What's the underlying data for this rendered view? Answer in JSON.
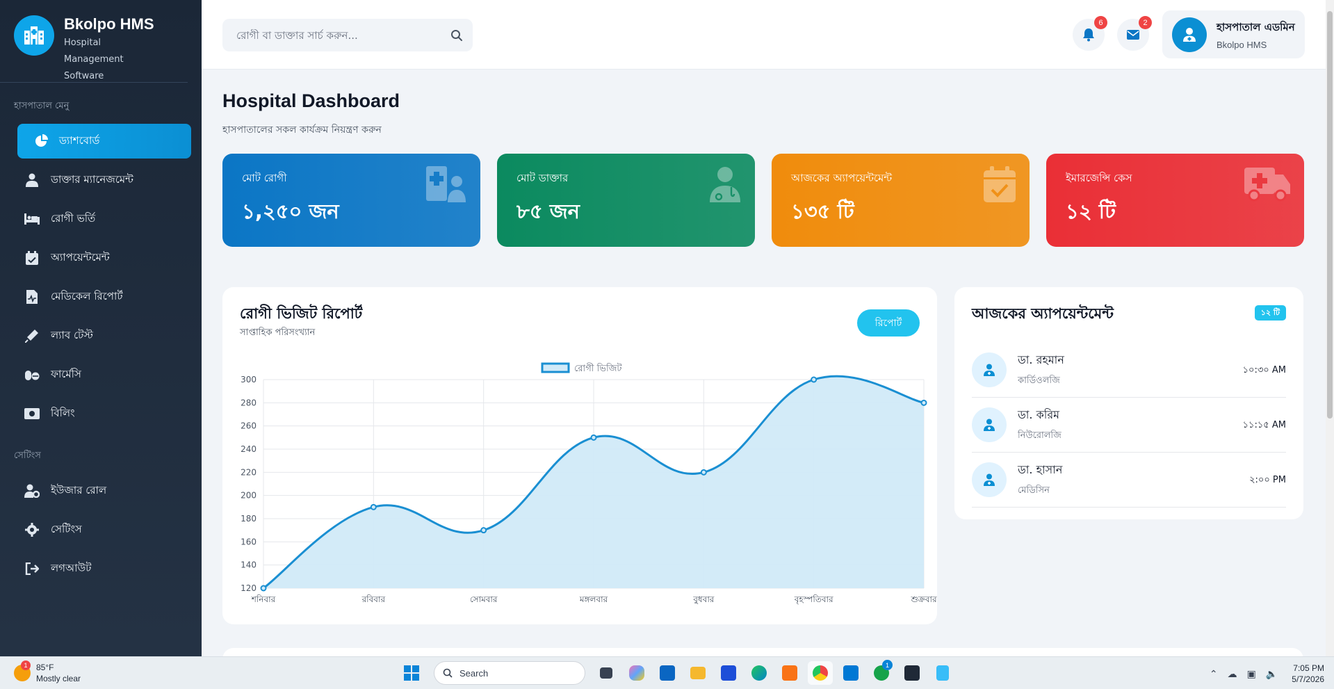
{
  "brand": {
    "name": "Bkolpo HMS",
    "subtitle": "Hospital Management Software"
  },
  "sidebar": {
    "menu_title": "হাসপাতাল মেনু",
    "items": [
      {
        "label": "ড্যাশবোর্ড",
        "icon": "pie-chart-icon",
        "active": true
      },
      {
        "label": "ডাক্তার ম্যানেজমেন্ট",
        "icon": "user-doctor-icon"
      },
      {
        "label": "রোগী ভর্তি",
        "icon": "bed-icon"
      },
      {
        "label": "অ্যাপয়েন্টমেন্ট",
        "icon": "calendar-check-icon"
      },
      {
        "label": "মেডিকেল রিপোর্ট",
        "icon": "file-medical-icon"
      },
      {
        "label": "ল্যাব টেস্ট",
        "icon": "syringe-icon"
      },
      {
        "label": "ফার্মেসি",
        "icon": "pills-icon"
      },
      {
        "label": "বিলিং",
        "icon": "money-bill-icon"
      }
    ],
    "settings_title": "সেটিংস",
    "settings_items": [
      {
        "label": "ইউজার রোল",
        "icon": "user-gear-icon"
      },
      {
        "label": "সেটিংস",
        "icon": "gear-icon"
      },
      {
        "label": "লগআউট",
        "icon": "logout-icon"
      }
    ]
  },
  "header": {
    "search_placeholder": "রোগী বা ডাক্তার সার্চ করুন...",
    "notifications_count": "6",
    "messages_count": "2",
    "user_name": "হাসপাতাল এডমিন",
    "user_role": "Bkolpo HMS"
  },
  "page": {
    "title": "Hospital Dashboard",
    "subtitle": "হাসপাতালের সকল কার্যক্রম নিয়ন্ত্রণ করুন"
  },
  "stats": [
    {
      "label": "মোট রোগী",
      "value": "১,২৫০ জন",
      "color": "#0b76c5",
      "icon": "hospital-user-icon"
    },
    {
      "label": "মোট ডাক্তার",
      "value": "৮৫ জন",
      "color": "#0b8a5f",
      "icon": "user-doctor-icon"
    },
    {
      "label": "আজকের অ্যাপয়েন্টমেন্ট",
      "value": "১৩৫ টি",
      "color": "#f08c0c",
      "icon": "calendar-check-icon"
    },
    {
      "label": "ইমারজেন্সি কেস",
      "value": "১২ টি",
      "color": "#ea2f36",
      "icon": "ambulance-icon"
    }
  ],
  "visit_chart": {
    "title": "রোগী ভিজিট রিপোর্ট",
    "subtitle": "সাপ্তাহিক পরিসংখ্যান",
    "button": "রিপোর্ট"
  },
  "chart_data": {
    "type": "area",
    "categories": [
      "শনিবার",
      "রবিবার",
      "সোমবার",
      "মঙ্গলবার",
      "বুধবার",
      "বৃহস্পতিবার",
      "শুক্রবার"
    ],
    "series": [
      {
        "name": "রোগী ভিজিট",
        "values": [
          120,
          190,
          170,
          250,
          220,
          300,
          280
        ]
      }
    ],
    "ylim": [
      120,
      300
    ],
    "yticks": [
      120,
      140,
      160,
      180,
      200,
      220,
      240,
      260,
      280,
      300
    ],
    "legend": "top-center",
    "grid": true,
    "color": "#1a8fd2",
    "fill": "#d1eaf8"
  },
  "appointments": {
    "title": "আজকের অ্যাপয়েন্টমেন্ট",
    "badge": "১২ টি",
    "items": [
      {
        "name": "ডা. রহমান",
        "dept": "কার্ডিওলজি",
        "time": "১০:৩০ AM"
      },
      {
        "name": "ডা. করিম",
        "dept": "নিউরোলজি",
        "time": "১১:১৫ AM"
      },
      {
        "name": "ডা. হাসান",
        "dept": "মেডিসিন",
        "time": "২:০০ PM"
      }
    ]
  },
  "taskbar": {
    "weather_temp": "85°F",
    "weather_desc": "Mostly clear",
    "weather_badge": "1",
    "search_label": "Search",
    "time": "7:05 PM",
    "date": "5/7/2026",
    "whatsapp_badge": "1"
  }
}
